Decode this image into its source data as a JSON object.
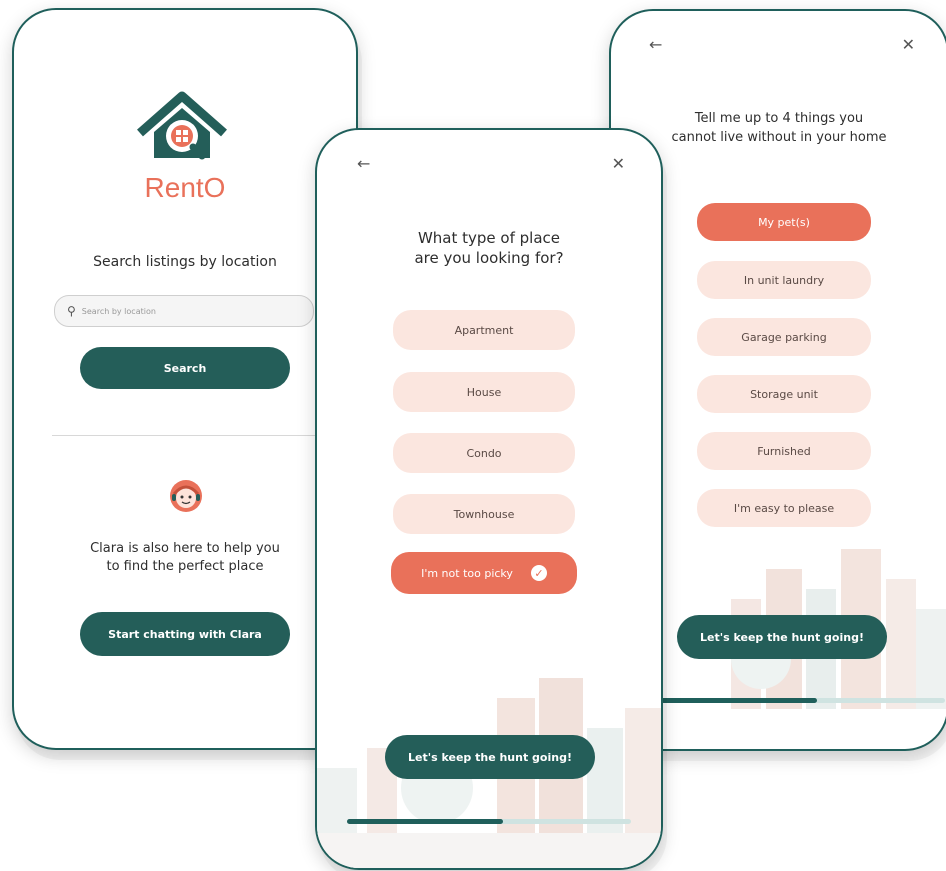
{
  "left_screen": {
    "logo_text": "RentO",
    "search_heading": "Search listings by location",
    "search_placeholder": "Search by location",
    "search_button": "Search",
    "helper_text_line1": "Clara is also here to help you",
    "helper_text_line2": "to find the perfect place",
    "chat_button": "Start chatting with Clara"
  },
  "middle_screen": {
    "back_icon": "arrow-left-icon",
    "close_icon": "close-icon",
    "question_line1": "What type of place",
    "question_line2": "are you looking for?",
    "options": [
      {
        "label": "Apartment",
        "selected": false
      },
      {
        "label": "House",
        "selected": false
      },
      {
        "label": "Condo",
        "selected": false
      },
      {
        "label": "Townhouse",
        "selected": false
      },
      {
        "label": "I'm not too picky",
        "selected": true
      }
    ],
    "continue_button": "Let's keep the hunt going!",
    "progress": 0.55
  },
  "right_screen": {
    "back_icon": "arrow-left-icon",
    "close_icon": "close-icon",
    "question_line1": "Tell me up to 4 things you",
    "question_line2": "cannot live without in your home",
    "options": [
      {
        "label": "My pet(s)",
        "selected": true
      },
      {
        "label": "In unit laundry",
        "selected": false
      },
      {
        "label": "Garage parking",
        "selected": false
      },
      {
        "label": "Storage unit",
        "selected": false
      },
      {
        "label": "Furnished",
        "selected": false
      },
      {
        "label": "I'm easy to please",
        "selected": false
      }
    ],
    "continue_button": "Let's keep the hunt going!",
    "progress": 0.55
  },
  "colors": {
    "brand_teal": "#245e59",
    "brand_coral": "#e9715a",
    "chip_bg": "#fbe6df"
  }
}
